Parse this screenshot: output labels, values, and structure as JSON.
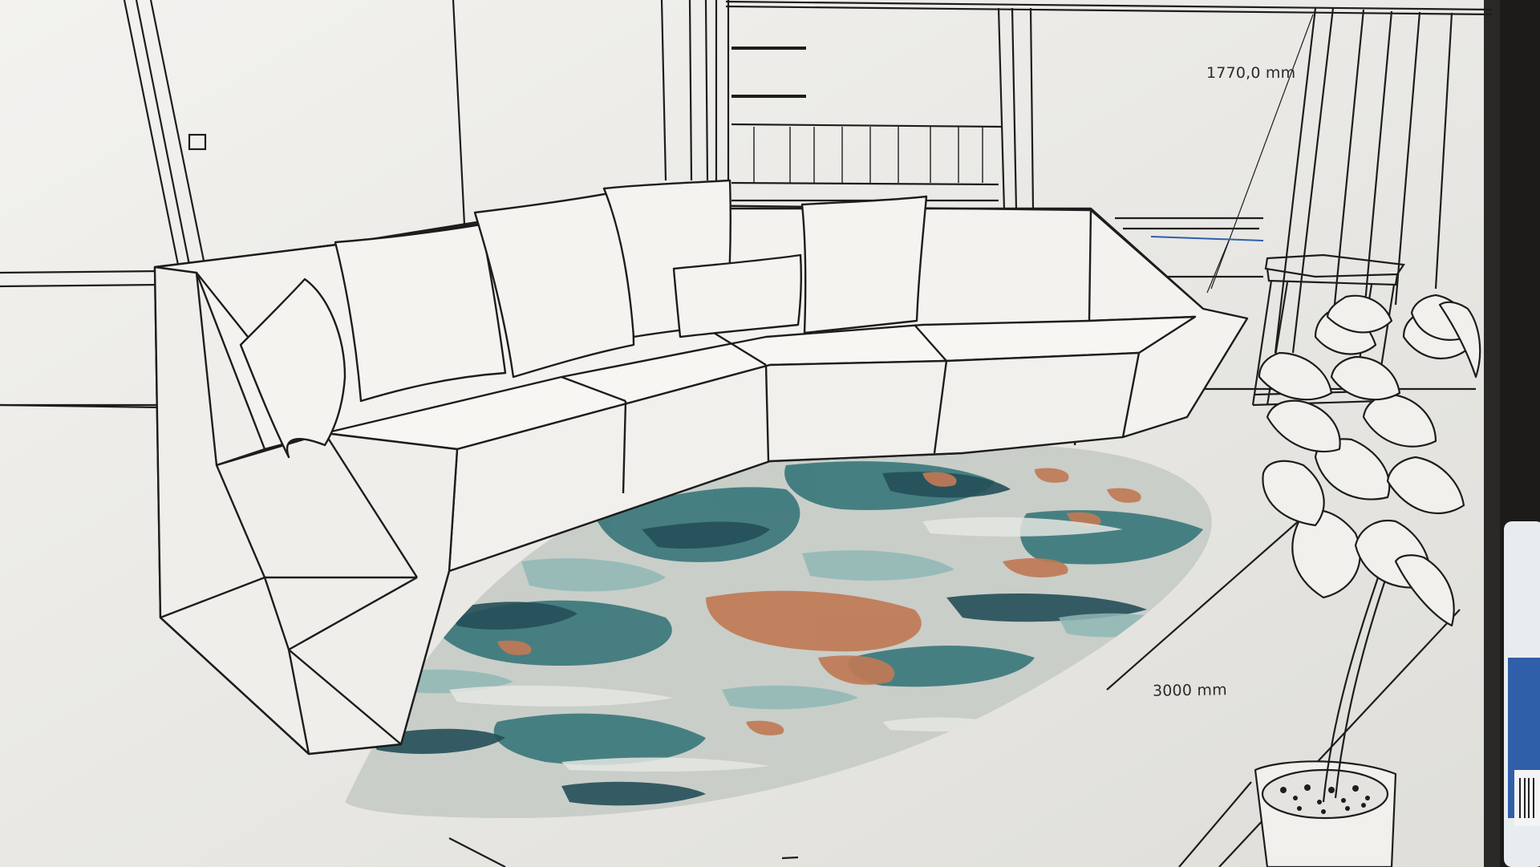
{
  "dimensions": {
    "height_label": "1770,0 mm",
    "width_label": "3000 mm"
  },
  "colors": {
    "paper": "#ebeae6",
    "line": "#1d1d1d",
    "rug_base": "#c9cec9",
    "rug_teal": "#3f7a7e",
    "rug_dark_teal": "#244f58",
    "rug_light_teal": "#8fb7b5",
    "rug_rust": "#c07a55",
    "monitor_bezel": "#1a1a1a",
    "bottle_blue": "#2f5fa8"
  },
  "icons": [
    "sofa-icon",
    "cushion-icon",
    "rug-icon",
    "plant-icon",
    "side-table-icon"
  ]
}
